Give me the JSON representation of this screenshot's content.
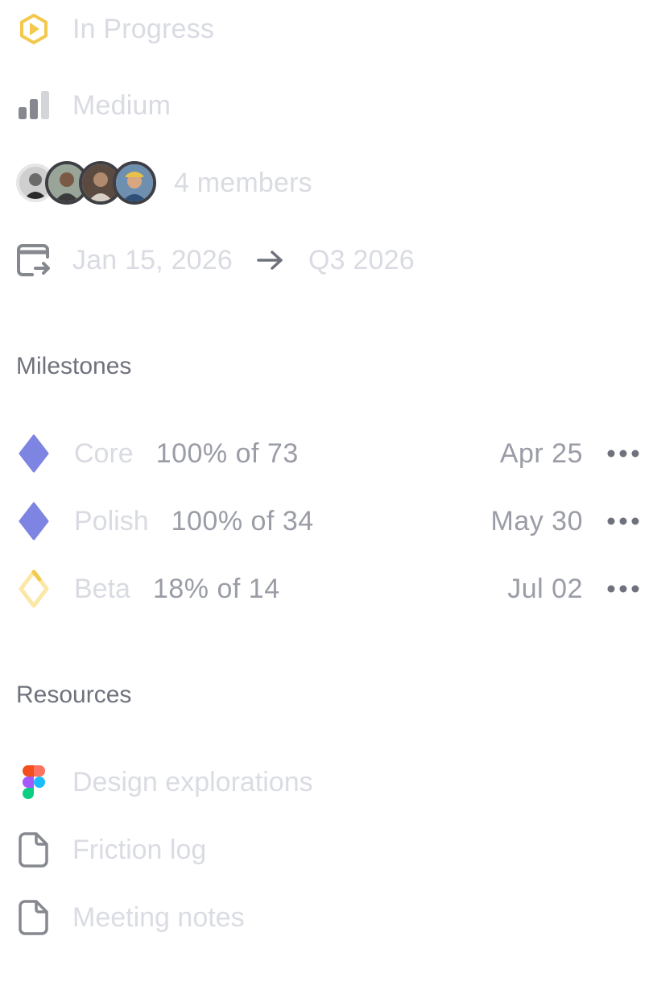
{
  "properties": {
    "status": {
      "label": "In Progress",
      "icon": "status-in-progress-icon",
      "color": "#F2C94C"
    },
    "priority": {
      "label": "Medium",
      "icon": "priority-medium-icon"
    },
    "members": {
      "label": "4 members",
      "count": 4
    },
    "dates": {
      "start": "Jan 15, 2026",
      "arrow": "→",
      "target": "Q3 2026",
      "icon": "calendar-arrow-icon"
    }
  },
  "milestones": {
    "title": "Milestones",
    "items": [
      {
        "name": "Core",
        "progress_percent": "100%",
        "of_label": "of",
        "total": "73",
        "date": "Apr 25",
        "icon": "diamond-complete-icon",
        "color": "#7E84E2",
        "progress": 1.0
      },
      {
        "name": "Polish",
        "progress_percent": "100%",
        "of_label": "of",
        "total": "34",
        "date": "May 30",
        "icon": "diamond-complete-icon",
        "color": "#7E84E2",
        "progress": 1.0
      },
      {
        "name": "Beta",
        "progress_percent": "18%",
        "of_label": "of",
        "total": "14",
        "date": "Jul 02",
        "icon": "diamond-partial-icon",
        "color": "#F2C94C",
        "progress": 0.18
      }
    ]
  },
  "resources": {
    "title": "Resources",
    "items": [
      {
        "label": "Design explorations",
        "icon": "figma-icon"
      },
      {
        "label": "Friction log",
        "icon": "document-icon"
      },
      {
        "label": "Meeting notes",
        "icon": "document-icon"
      }
    ]
  }
}
